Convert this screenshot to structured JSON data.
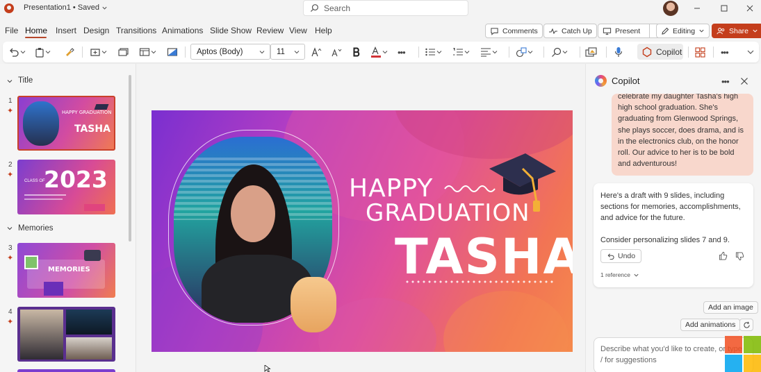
{
  "titlebar": {
    "doc_title": "Presentation1 • Saved",
    "search_placeholder": "Search"
  },
  "menu": {
    "items": [
      "File",
      "Home",
      "Insert",
      "Design",
      "Transitions",
      "Animations",
      "Slide Show",
      "Review",
      "View",
      "Help"
    ],
    "active": "Home",
    "comments_label": "Comments",
    "catchup_label": "Catch Up",
    "present_label": "Present",
    "editing_label": "Editing",
    "share_label": "Share"
  },
  "ribbon": {
    "font_name": "Aptos (Body)",
    "font_size": "11",
    "copilot_label": "Copilot",
    "more_label": "•••"
  },
  "thumbnails": {
    "sections": [
      "Title",
      "Memories"
    ],
    "slides": [
      {
        "num": "1",
        "heading": "HAPPY GRADUATION",
        "name": "TASHA"
      },
      {
        "num": "2",
        "heading": "CLASS OF",
        "year": "2023"
      },
      {
        "num": "3",
        "heading": "MEMORIES"
      },
      {
        "num": "4"
      }
    ]
  },
  "slide": {
    "line1": "HAPPY",
    "line2": "GRADUATION",
    "name": "TASHA"
  },
  "copilot": {
    "title": "Copilot",
    "user_message": "celebrate my daughter Tasha's high high school graduation. She's graduating from Glenwood Springs, she plays soccer, does drama, and is in the electronics club, on the honor roll. Our advice to her is to be bold and adventurous!",
    "user_lines": [
      "celebrate my daughter Tasha's high",
      "high school graduation. She's",
      "graduating from Glenwood Springs,",
      "she plays soccer, does drama, and is",
      "in the electronics club, on the honor",
      "roll. Our advice to her is to be bold",
      "and adventurous!"
    ],
    "response_lines": [
      "Here's a draft with 9 slides, including",
      "sections for memories, accomplishments,",
      "and advice for the future."
    ],
    "response_followup": "Consider personalizing slides 7 and 9.",
    "undo_label": "Undo",
    "reference_label": "1 reference",
    "suggestions": [
      "Add an image",
      "Add animations"
    ],
    "prompt_placeholder_lines": [
      "Describe what you'd like to create, or type",
      "/ for suggestions"
    ]
  },
  "colors": {
    "accent": "#c43e1c",
    "user_bubble": "#f8d7cc"
  }
}
